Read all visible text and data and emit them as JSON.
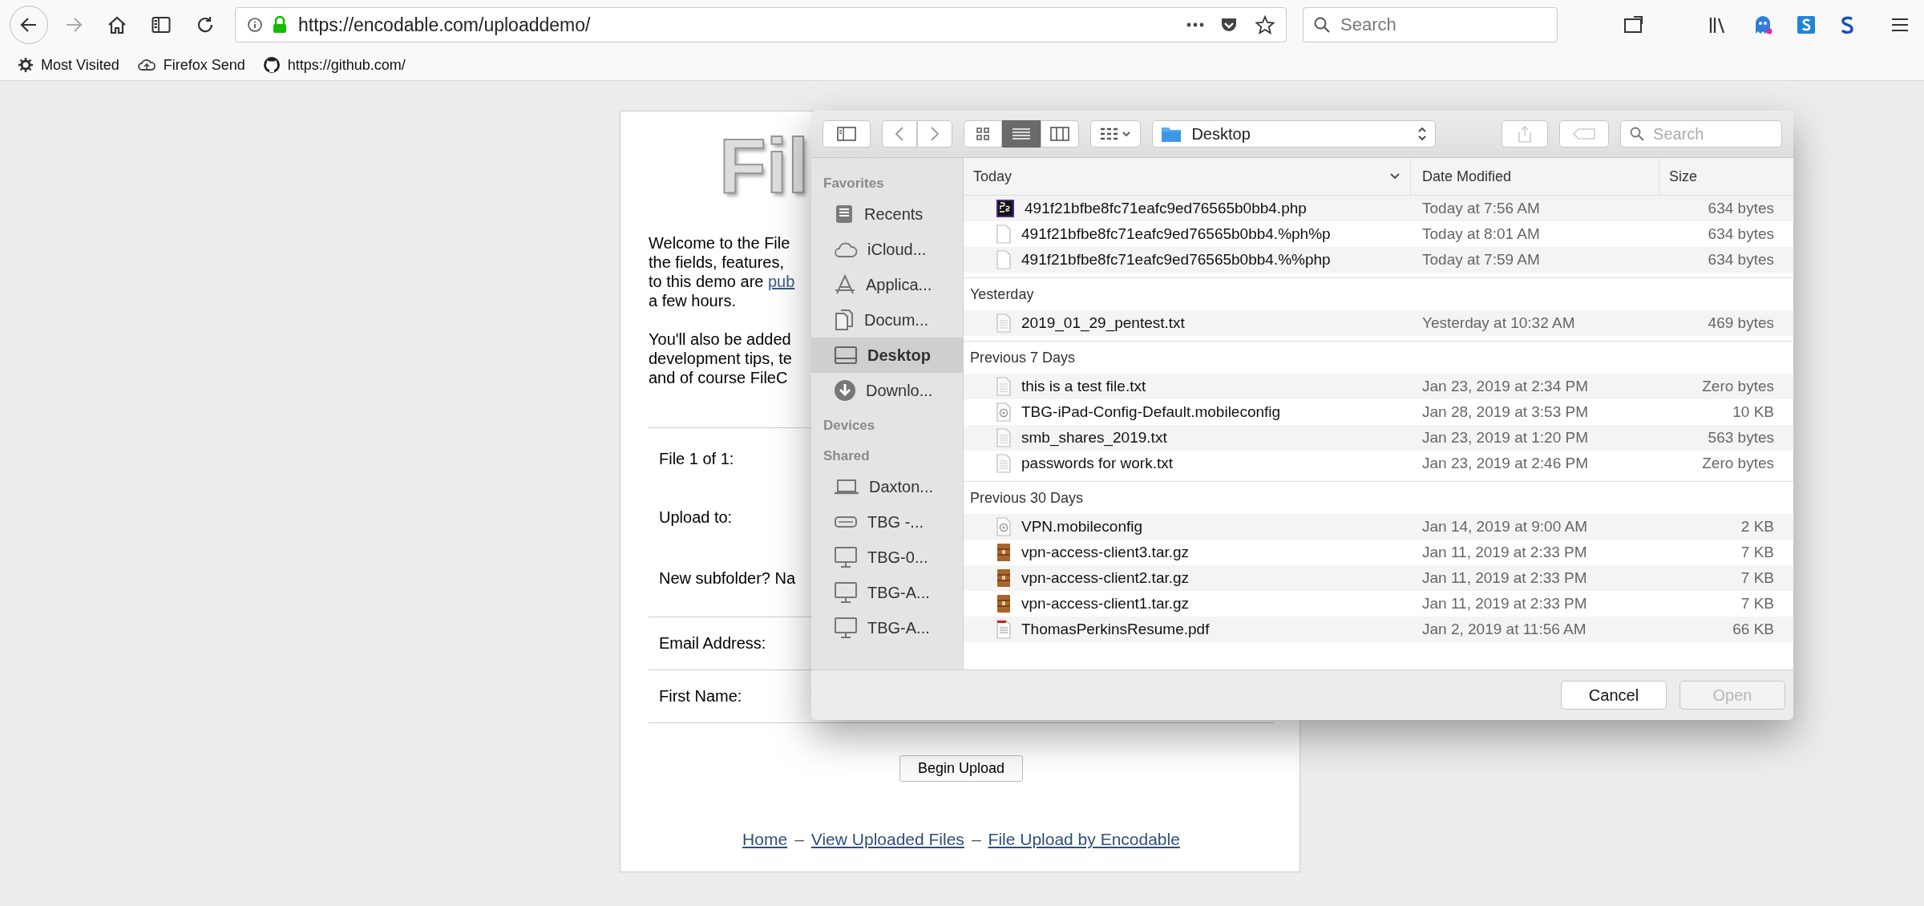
{
  "browser": {
    "url": "https://encodable.com/uploaddemo/",
    "search": {
      "placeholder": "Search"
    },
    "bookmarks": [
      {
        "kind": "gear",
        "label": "Most Visited"
      },
      {
        "kind": "cloud",
        "label": "Firefox Send"
      },
      {
        "kind": "github",
        "label": "https://github.com/"
      }
    ]
  },
  "page": {
    "logo": "Fil",
    "intro_lines": [
      "Welcome to the File",
      "the fields, features,",
      "to this demo are **pub**",
      "a few hours."
    ],
    "second_lines": [
      "You'll also be added",
      "development tips, te",
      "and of course FileC"
    ],
    "form_rows": [
      {
        "label": "File 1 of 1:",
        "divider": false
      },
      {
        "label": "Upload to:",
        "divider": false
      },
      {
        "label": "New subfolder? Na",
        "divider": true
      },
      {
        "label": "Email Address:",
        "divider": true
      },
      {
        "label": "First Name:",
        "divider": true
      }
    ],
    "submit": "Begin Upload",
    "footer_links": [
      "Home",
      "View Uploaded Files",
      "File Upload by Encodable"
    ],
    "separator": "–"
  },
  "dialog": {
    "location": "Desktop",
    "search": {
      "placeholder": "Search"
    },
    "views": [
      {
        "kind": "icons",
        "selected": false
      },
      {
        "kind": "list",
        "selected": true
      },
      {
        "kind": "columns",
        "selected": false
      }
    ],
    "sidebar": [
      {
        "heading": "Favorites",
        "items": [
          {
            "kind": "recents",
            "label": "Recents",
            "selected": false
          },
          {
            "kind": "cloud",
            "label": "iCloud...",
            "selected": false
          },
          {
            "kind": "apps",
            "label": "Applica...",
            "selected": false
          },
          {
            "kind": "docs",
            "label": "Docum...",
            "selected": false
          },
          {
            "kind": "desktop",
            "label": "Desktop",
            "selected": true
          },
          {
            "kind": "download",
            "label": "Downlo...",
            "selected": false
          }
        ]
      },
      {
        "heading": "Devices"
      },
      {
        "heading": "Shared",
        "items": [
          {
            "kind": "laptop",
            "label": "Daxton...",
            "selected": false
          },
          {
            "kind": "drive",
            "label": "TBG -...",
            "selected": false
          },
          {
            "kind": "monitor",
            "label": "TBG-0...",
            "selected": false
          },
          {
            "kind": "monitor",
            "label": "TBG-A...",
            "selected": false
          },
          {
            "kind": "monitor",
            "label": "TBG-A...",
            "selected": false
          }
        ]
      }
    ],
    "columns": [
      "Today",
      "Date Modified",
      "Size"
    ],
    "groups": [
      {
        "rows": [
          {
            "kind": "php",
            "name": "491f21bfbe8fc71eafc9ed76565b0bb4.php",
            "date": "Today at 7:56 AM",
            "size": "634 bytes"
          },
          {
            "kind": "blank",
            "name": "491f21bfbe8fc71eafc9ed76565b0bb4.%ph%p",
            "date": "Today at 8:01 AM",
            "size": "634 bytes"
          },
          {
            "kind": "blank",
            "name": "491f21bfbe8fc71eafc9ed76565b0bb4.%%php",
            "date": "Today at 7:59 AM",
            "size": "634 bytes"
          }
        ]
      },
      {
        "heading": "Yesterday",
        "rows": [
          {
            "kind": "text",
            "name": "2019_01_29_pentest.txt",
            "date": "Yesterday at 10:32 AM",
            "size": "469 bytes"
          }
        ]
      },
      {
        "heading": "Previous 7 Days",
        "rows": [
          {
            "kind": "text",
            "name": "this is a test file.txt",
            "date": "Jan 23, 2019 at 2:34 PM",
            "size": "Zero bytes"
          },
          {
            "kind": "config",
            "name": "TBG-iPad-Config-Default.mobileconfig",
            "date": "Jan 28, 2019 at 3:53 PM",
            "size": "10 KB"
          },
          {
            "kind": "text",
            "name": "smb_shares_2019.txt",
            "date": "Jan 23, 2019 at 1:20 PM",
            "size": "563 bytes"
          },
          {
            "kind": "text",
            "name": "passwords for work.txt",
            "date": "Jan 23, 2019 at 2:46 PM",
            "size": "Zero bytes"
          }
        ]
      },
      {
        "heading": "Previous 30 Days",
        "rows": [
          {
            "kind": "config",
            "name": "VPN.mobileconfig",
            "date": "Jan 14, 2019 at 9:00 AM",
            "size": "2 KB"
          },
          {
            "kind": "archive",
            "name": "vpn-access-client3.tar.gz",
            "date": "Jan 11, 2019 at 2:33 PM",
            "size": "7 KB"
          },
          {
            "kind": "archive",
            "name": "vpn-access-client2.tar.gz",
            "date": "Jan 11, 2019 at 2:33 PM",
            "size": "7 KB"
          },
          {
            "kind": "archive",
            "name": "vpn-access-client1.tar.gz",
            "date": "Jan 11, 2019 at 2:33 PM",
            "size": "7 KB"
          },
          {
            "kind": "pdf",
            "name": "ThomasPerkinsResume.pdf",
            "date": "Jan 2, 2019 at 11:56 AM",
            "size": "66 KB"
          }
        ]
      }
    ],
    "buttons": [
      {
        "label": "Cancel",
        "disabled": false
      },
      {
        "label": "Open",
        "disabled": true
      }
    ]
  }
}
